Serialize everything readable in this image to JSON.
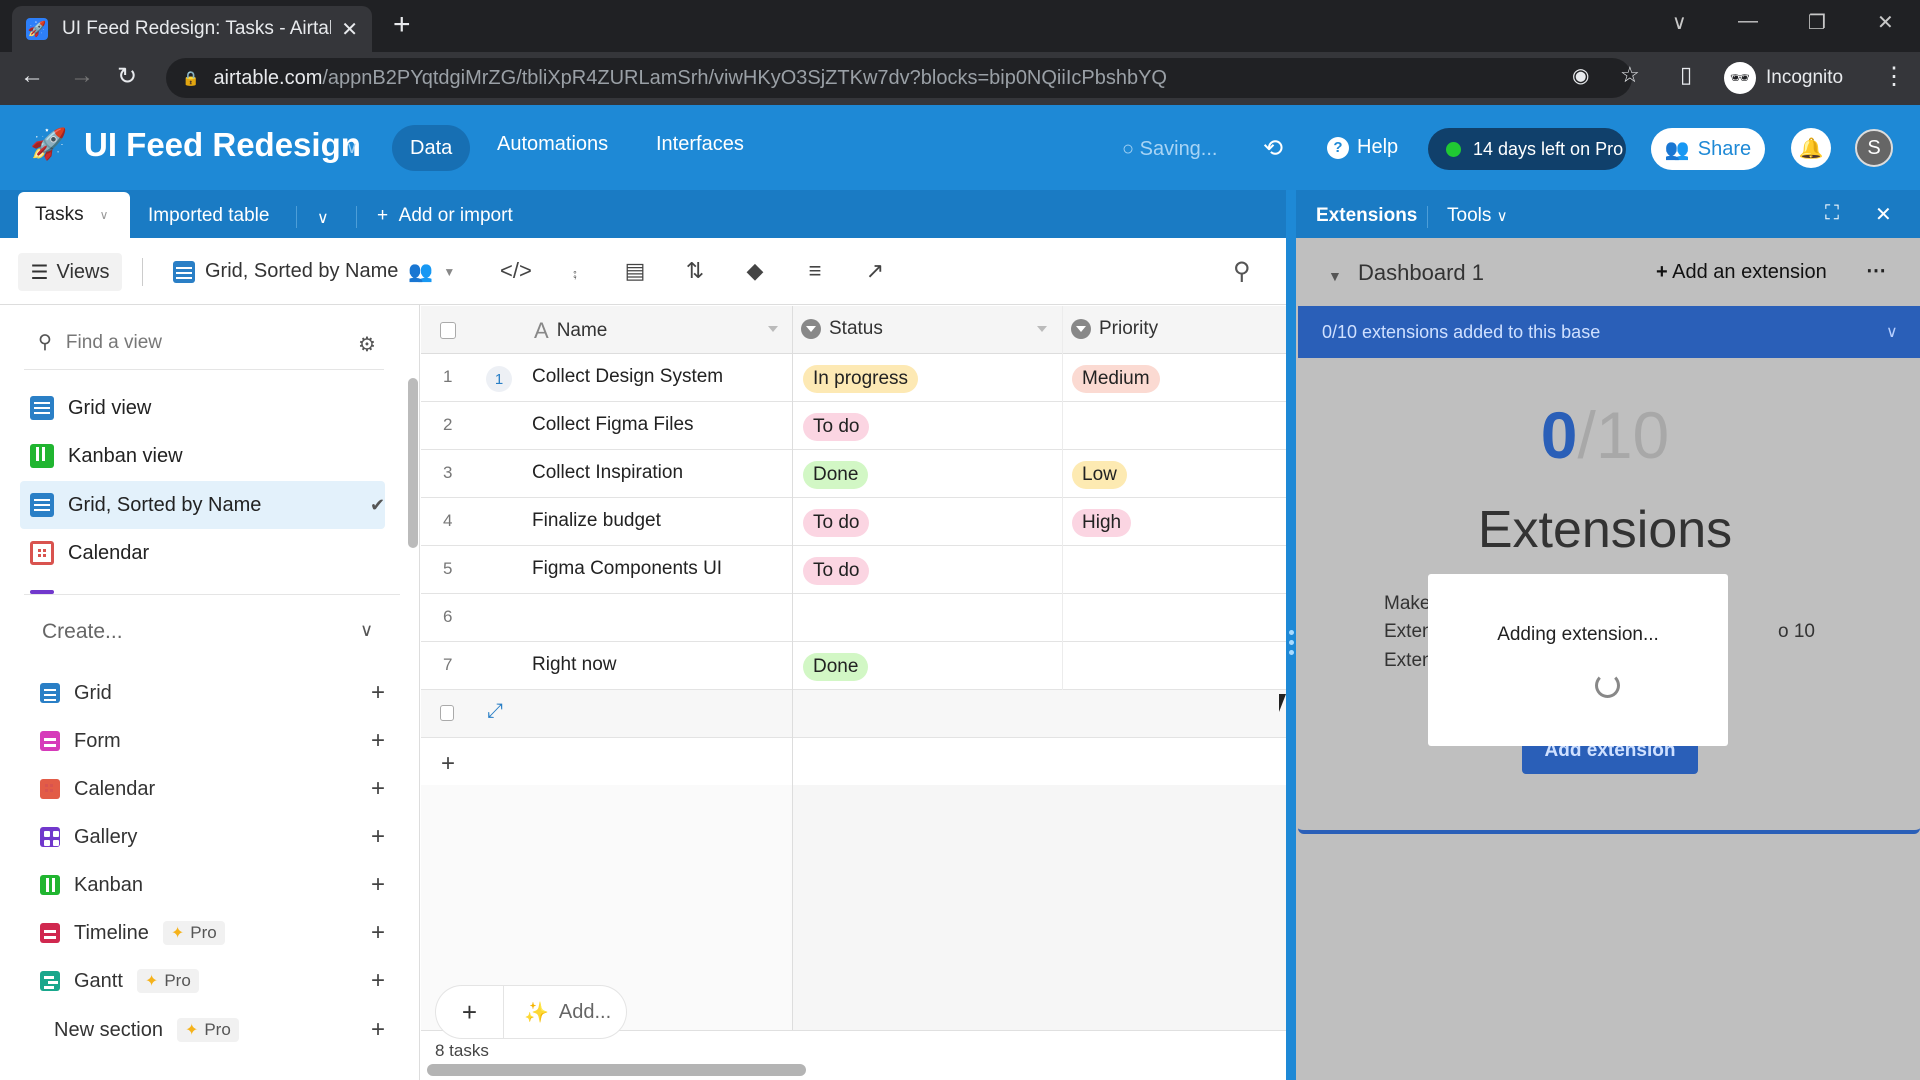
{
  "browser": {
    "tab_title": "UI Feed Redesign: Tasks - Airtable",
    "url_domain": "airtable.com",
    "url_path": "/appnB2PYqtdgiMrZG/tbliXpR4ZURLamSrh/viwHKyO3SjZTKw7dv?blocks=bip0NQiiIcPbshbYQ",
    "profile_label": "Incognito"
  },
  "header": {
    "base_name": "UI Feed Redesign",
    "nav": [
      "Data",
      "Automations",
      "Interfaces"
    ],
    "active_nav": "Data",
    "saving_label": "Saving...",
    "help_label": "Help",
    "trial_label": "14 days left on Pro",
    "share_label": "Share",
    "avatar_initial": "S"
  },
  "table_tabs": {
    "active": "Tasks",
    "other": "Imported table",
    "add_label": "Add or import"
  },
  "toolbar": {
    "views_label": "Views",
    "current_view": "Grid, Sorted by Name",
    "icons": [
      "hide-fields-icon",
      "filter-icon",
      "group-icon",
      "sort-icon",
      "color-icon",
      "row-height-icon",
      "share-view-icon"
    ]
  },
  "sidebar": {
    "find_placeholder": "Find a view",
    "views": [
      {
        "label": "Grid view",
        "type": "grid",
        "selected": false
      },
      {
        "label": "Kanban view",
        "type": "kanban",
        "selected": false
      },
      {
        "label": "Grid, Sorted by Name",
        "type": "grid",
        "selected": true
      },
      {
        "label": "Calendar",
        "type": "cal",
        "selected": false
      }
    ],
    "create_label": "Create...",
    "create_items": [
      {
        "label": "Grid",
        "type": "grid",
        "pro": false
      },
      {
        "label": "Form",
        "type": "form",
        "pro": false
      },
      {
        "label": "Calendar",
        "type": "cal",
        "pro": false
      },
      {
        "label": "Gallery",
        "type": "gal",
        "pro": false
      },
      {
        "label": "Kanban",
        "type": "kanban",
        "pro": false
      },
      {
        "label": "Timeline",
        "type": "tl",
        "pro": true
      },
      {
        "label": "Gantt",
        "type": "gantt",
        "pro": true
      }
    ],
    "new_section_label": "New section",
    "pro_label": "Pro"
  },
  "grid": {
    "columns": [
      "Name",
      "Status",
      "Priority"
    ],
    "rows": [
      {
        "num": "1",
        "name": "Collect Design System",
        "status": "In progress",
        "priority": "Medium",
        "comments": "1"
      },
      {
        "num": "2",
        "name": "Collect Figma Files",
        "status": "To do",
        "priority": ""
      },
      {
        "num": "3",
        "name": "Collect Inspiration",
        "status": "Done",
        "priority": "Low"
      },
      {
        "num": "4",
        "name": "Finalize budget",
        "status": "To do",
        "priority": "High"
      },
      {
        "num": "5",
        "name": "Figma Components UI",
        "status": "To do",
        "priority": ""
      },
      {
        "num": "6",
        "name": "",
        "status": "",
        "priority": ""
      },
      {
        "num": "7",
        "name": "Right now",
        "status": "Done",
        "priority": ""
      }
    ],
    "pill_colors": {
      "In progress": "#fde9b4",
      "To do": "#fbd5e2",
      "Done": "#d2f7c5",
      "Medium": "#fbdad2",
      "Low": "#fdeab2",
      "High": "#fbd5e2"
    },
    "add_label": "Add...",
    "record_count": "8 tasks"
  },
  "extensions": {
    "title": "Extensions",
    "tools_label": "Tools",
    "dashboard_name": "Dashboard 1",
    "add_extension_label": "Add an extension",
    "banner": "0/10 extensions added to this base",
    "count_used": "0",
    "count_total": "/10",
    "big_title": "Extensions",
    "desc_lines": [
      "Make",
      "Exten",
      "Exten"
    ],
    "desc_tail": "o 10",
    "add_button": "Add extension",
    "modal_text": "Adding extension..."
  }
}
